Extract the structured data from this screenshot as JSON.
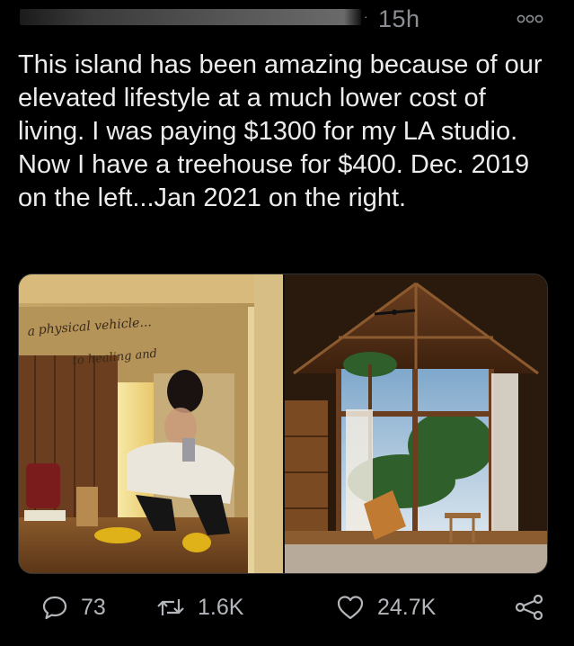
{
  "post": {
    "time": "15h",
    "separator": "·",
    "text": "This island has been amazing because of our elevated lifestyle at a much lower cost of living. I was paying $1300 for my LA studio. Now I have a treehouse for $400. Dec. 2019 on the left...Jan 2021 on the right."
  },
  "media": {
    "left_photo": {
      "mirror_text_line1": "physical vehicle...",
      "mirror_text_line2": "to healing and"
    }
  },
  "actions": {
    "replies": "73",
    "retweets": "1.6K",
    "likes": "24.7K"
  },
  "icons": {
    "more": "more-options-icon",
    "reply": "reply-bubble-icon",
    "retweet": "retweet-icon",
    "like": "heart-icon",
    "share": "share-icon"
  },
  "colors": {
    "background": "#000000",
    "text": "#ececec",
    "muted": "#8b8f94"
  }
}
